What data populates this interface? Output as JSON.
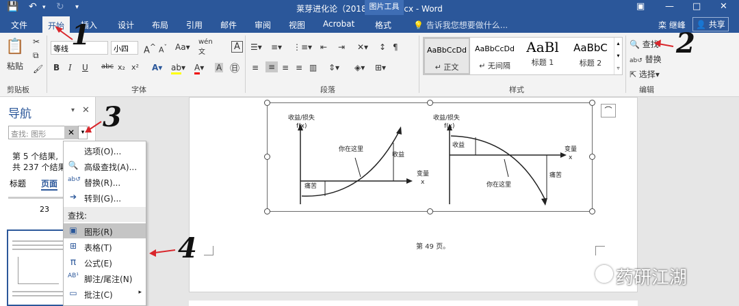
{
  "title": {
    "document": "莱芽进化论（2018精选）.docx - Word",
    "picture_tools": "图片工具",
    "user": "栾 继峰",
    "share": "共享"
  },
  "tabs": [
    {
      "label": "文件"
    },
    {
      "label": "开始",
      "active": true
    },
    {
      "label": "插入"
    },
    {
      "label": "设计"
    },
    {
      "label": "布局"
    },
    {
      "label": "引用"
    },
    {
      "label": "邮件"
    },
    {
      "label": "审阅"
    },
    {
      "label": "视图"
    },
    {
      "label": "Acrobat"
    },
    {
      "label": "格式"
    }
  ],
  "tell_me": "告诉我您想要做什么...",
  "ribbon": {
    "clipboard": {
      "paste": "粘贴",
      "label": "剪贴板"
    },
    "font": {
      "family": "等线",
      "size": "小四",
      "label": "字体",
      "bold": "B",
      "italic": "I",
      "underline": "U",
      "strike": "abc",
      "sub": "x₂",
      "sup": "x²",
      "grow": "A",
      "shrink": "A",
      "case": "Aa",
      "pinyin": "wén",
      "border": "A"
    },
    "paragraph": {
      "label": "段落"
    },
    "styles": {
      "label": "样式",
      "items": [
        {
          "sample": "AaBbCcDd",
          "name": "↵ 正文"
        },
        {
          "sample": "AaBbCcDd",
          "name": "↵ 无间隔"
        },
        {
          "sample": "AaBl",
          "name": "标题 1"
        },
        {
          "sample": "AaBbC",
          "name": "标题 2"
        }
      ]
    },
    "editing": {
      "find": "查找",
      "replace": "替换",
      "select": "选择",
      "label": "编辑"
    }
  },
  "nav": {
    "title": "导航",
    "search_placeholder": "查找: 图形",
    "result_count": "第 5 个结果,",
    "result_total": "共 237 个结果",
    "tab_headings": "标题",
    "tab_pages": "页面",
    "page_number": "23"
  },
  "menu": {
    "options": "选项(O)...",
    "advanced_find": "高级查找(A)...",
    "replace": "替换(R)...",
    "goto": "转到(G)...",
    "find_header": "查找:",
    "graphics": "图形(R)",
    "tables": "表格(T)",
    "equations": "公式(E)",
    "footnotes": "脚注/尾注(N)",
    "comments": "批注(C)"
  },
  "chart": {
    "left": {
      "ylabel1": "收益/损失",
      "ylabel2": "f(x)",
      "here": "你在这里",
      "gain": "收益",
      "pain": "痛苦",
      "xlabel1": "变量",
      "xlabel2": "x"
    },
    "right": {
      "ylabel1": "收益/损失",
      "ylabel2": "f(x)",
      "gain": "收益",
      "here": "你在这里",
      "pain": "痛苦",
      "xlabel1": "变量",
      "xlabel2": "x"
    }
  },
  "page_footer": "第 49 页。",
  "annotations": [
    "1",
    "2",
    "3",
    "4"
  ],
  "watermark": "药研江湖",
  "colors": {
    "word_blue": "#2b579a",
    "annotation_red": "#d9262b"
  }
}
